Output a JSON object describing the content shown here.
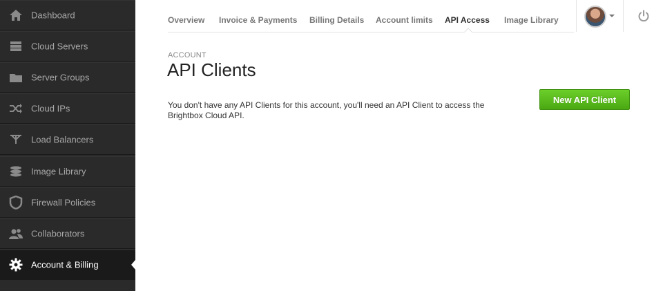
{
  "sidebar": {
    "items": [
      {
        "label": "Dashboard",
        "icon": "home-icon"
      },
      {
        "label": "Cloud Servers",
        "icon": "server-icon"
      },
      {
        "label": "Server Groups",
        "icon": "folder-icon"
      },
      {
        "label": "Cloud IPs",
        "icon": "shuffle-icon"
      },
      {
        "label": "Load Balancers",
        "icon": "load-balancer-icon"
      },
      {
        "label": "Image Library",
        "icon": "database-icon"
      },
      {
        "label": "Firewall Policies",
        "icon": "shield-icon"
      },
      {
        "label": "Collaborators",
        "icon": "users-icon"
      },
      {
        "label": "Account & Billing",
        "icon": "gear-icon",
        "active": true
      }
    ]
  },
  "topnav": {
    "tabs": [
      {
        "label": "Overview"
      },
      {
        "label": "Invoice & Payments"
      },
      {
        "label": "Billing Details"
      },
      {
        "label": "Account limits"
      },
      {
        "label": "API Access",
        "active": true
      },
      {
        "label": "Image Library"
      }
    ]
  },
  "main": {
    "eyebrow": "ACCOUNT",
    "title": "API Clients",
    "message": "You don't have any API Clients for this account, you'll need an API Client to access the Brightbox Cloud API.",
    "new_button_label": "New API Client"
  },
  "colors": {
    "sidebar_bg": "#2a2a2a",
    "accent_green": "#4aa812"
  }
}
